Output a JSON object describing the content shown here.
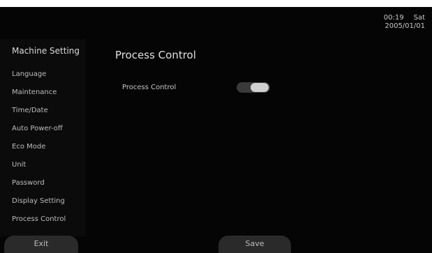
{
  "status": {
    "time": "00:19",
    "day": "Sat",
    "date": "2005/01/01"
  },
  "sidebar": {
    "title": "Machine Setting",
    "items": [
      {
        "label": "Language"
      },
      {
        "label": "Maintenance"
      },
      {
        "label": "Time/Date"
      },
      {
        "label": "Auto Power-off"
      },
      {
        "label": "Eco Mode"
      },
      {
        "label": "Unit"
      },
      {
        "label": "Password"
      },
      {
        "label": "Display Setting"
      },
      {
        "label": "Process Control"
      }
    ]
  },
  "main": {
    "title": "Process Control",
    "settings": [
      {
        "label": "Process Control",
        "enabled": true
      }
    ]
  },
  "footer": {
    "exit_label": "Exit",
    "save_label": "Save"
  }
}
